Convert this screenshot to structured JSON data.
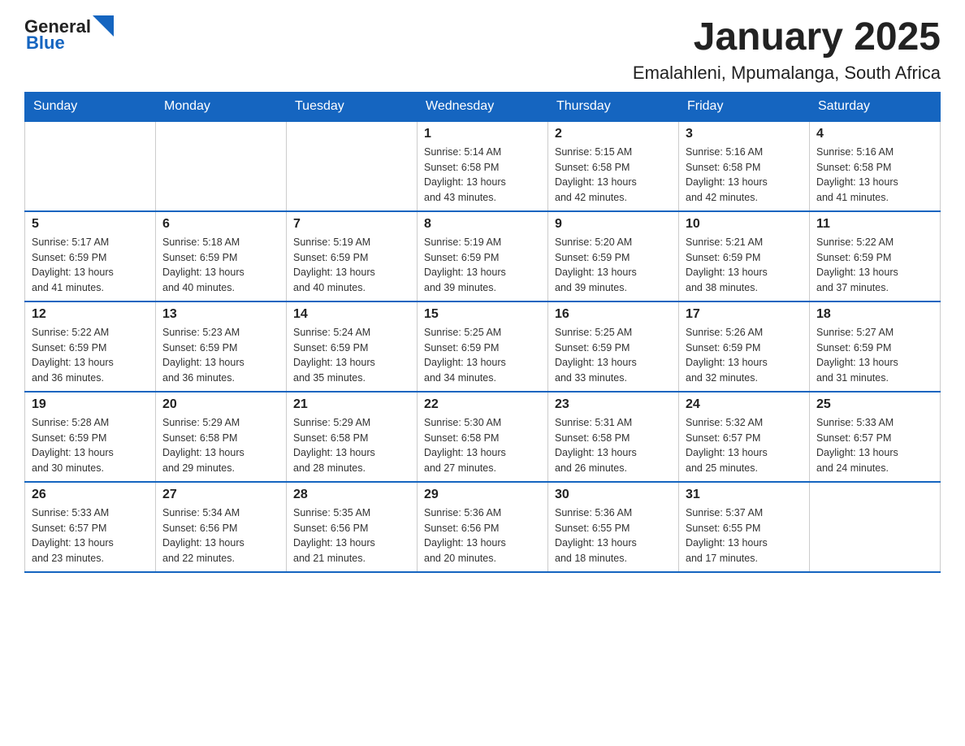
{
  "header": {
    "logo": {
      "text_general": "General",
      "text_blue": "Blue"
    },
    "title": "January 2025",
    "location": "Emalahleni, Mpumalanga, South Africa"
  },
  "weekdays": [
    "Sunday",
    "Monday",
    "Tuesday",
    "Wednesday",
    "Thursday",
    "Friday",
    "Saturday"
  ],
  "weeks": [
    [
      {
        "day": "",
        "info": ""
      },
      {
        "day": "",
        "info": ""
      },
      {
        "day": "",
        "info": ""
      },
      {
        "day": "1",
        "info": "Sunrise: 5:14 AM\nSunset: 6:58 PM\nDaylight: 13 hours\nand 43 minutes."
      },
      {
        "day": "2",
        "info": "Sunrise: 5:15 AM\nSunset: 6:58 PM\nDaylight: 13 hours\nand 42 minutes."
      },
      {
        "day": "3",
        "info": "Sunrise: 5:16 AM\nSunset: 6:58 PM\nDaylight: 13 hours\nand 42 minutes."
      },
      {
        "day": "4",
        "info": "Sunrise: 5:16 AM\nSunset: 6:58 PM\nDaylight: 13 hours\nand 41 minutes."
      }
    ],
    [
      {
        "day": "5",
        "info": "Sunrise: 5:17 AM\nSunset: 6:59 PM\nDaylight: 13 hours\nand 41 minutes."
      },
      {
        "day": "6",
        "info": "Sunrise: 5:18 AM\nSunset: 6:59 PM\nDaylight: 13 hours\nand 40 minutes."
      },
      {
        "day": "7",
        "info": "Sunrise: 5:19 AM\nSunset: 6:59 PM\nDaylight: 13 hours\nand 40 minutes."
      },
      {
        "day": "8",
        "info": "Sunrise: 5:19 AM\nSunset: 6:59 PM\nDaylight: 13 hours\nand 39 minutes."
      },
      {
        "day": "9",
        "info": "Sunrise: 5:20 AM\nSunset: 6:59 PM\nDaylight: 13 hours\nand 39 minutes."
      },
      {
        "day": "10",
        "info": "Sunrise: 5:21 AM\nSunset: 6:59 PM\nDaylight: 13 hours\nand 38 minutes."
      },
      {
        "day": "11",
        "info": "Sunrise: 5:22 AM\nSunset: 6:59 PM\nDaylight: 13 hours\nand 37 minutes."
      }
    ],
    [
      {
        "day": "12",
        "info": "Sunrise: 5:22 AM\nSunset: 6:59 PM\nDaylight: 13 hours\nand 36 minutes."
      },
      {
        "day": "13",
        "info": "Sunrise: 5:23 AM\nSunset: 6:59 PM\nDaylight: 13 hours\nand 36 minutes."
      },
      {
        "day": "14",
        "info": "Sunrise: 5:24 AM\nSunset: 6:59 PM\nDaylight: 13 hours\nand 35 minutes."
      },
      {
        "day": "15",
        "info": "Sunrise: 5:25 AM\nSunset: 6:59 PM\nDaylight: 13 hours\nand 34 minutes."
      },
      {
        "day": "16",
        "info": "Sunrise: 5:25 AM\nSunset: 6:59 PM\nDaylight: 13 hours\nand 33 minutes."
      },
      {
        "day": "17",
        "info": "Sunrise: 5:26 AM\nSunset: 6:59 PM\nDaylight: 13 hours\nand 32 minutes."
      },
      {
        "day": "18",
        "info": "Sunrise: 5:27 AM\nSunset: 6:59 PM\nDaylight: 13 hours\nand 31 minutes."
      }
    ],
    [
      {
        "day": "19",
        "info": "Sunrise: 5:28 AM\nSunset: 6:59 PM\nDaylight: 13 hours\nand 30 minutes."
      },
      {
        "day": "20",
        "info": "Sunrise: 5:29 AM\nSunset: 6:58 PM\nDaylight: 13 hours\nand 29 minutes."
      },
      {
        "day": "21",
        "info": "Sunrise: 5:29 AM\nSunset: 6:58 PM\nDaylight: 13 hours\nand 28 minutes."
      },
      {
        "day": "22",
        "info": "Sunrise: 5:30 AM\nSunset: 6:58 PM\nDaylight: 13 hours\nand 27 minutes."
      },
      {
        "day": "23",
        "info": "Sunrise: 5:31 AM\nSunset: 6:58 PM\nDaylight: 13 hours\nand 26 minutes."
      },
      {
        "day": "24",
        "info": "Sunrise: 5:32 AM\nSunset: 6:57 PM\nDaylight: 13 hours\nand 25 minutes."
      },
      {
        "day": "25",
        "info": "Sunrise: 5:33 AM\nSunset: 6:57 PM\nDaylight: 13 hours\nand 24 minutes."
      }
    ],
    [
      {
        "day": "26",
        "info": "Sunrise: 5:33 AM\nSunset: 6:57 PM\nDaylight: 13 hours\nand 23 minutes."
      },
      {
        "day": "27",
        "info": "Sunrise: 5:34 AM\nSunset: 6:56 PM\nDaylight: 13 hours\nand 22 minutes."
      },
      {
        "day": "28",
        "info": "Sunrise: 5:35 AM\nSunset: 6:56 PM\nDaylight: 13 hours\nand 21 minutes."
      },
      {
        "day": "29",
        "info": "Sunrise: 5:36 AM\nSunset: 6:56 PM\nDaylight: 13 hours\nand 20 minutes."
      },
      {
        "day": "30",
        "info": "Sunrise: 5:36 AM\nSunset: 6:55 PM\nDaylight: 13 hours\nand 18 minutes."
      },
      {
        "day": "31",
        "info": "Sunrise: 5:37 AM\nSunset: 6:55 PM\nDaylight: 13 hours\nand 17 minutes."
      },
      {
        "day": "",
        "info": ""
      }
    ]
  ]
}
